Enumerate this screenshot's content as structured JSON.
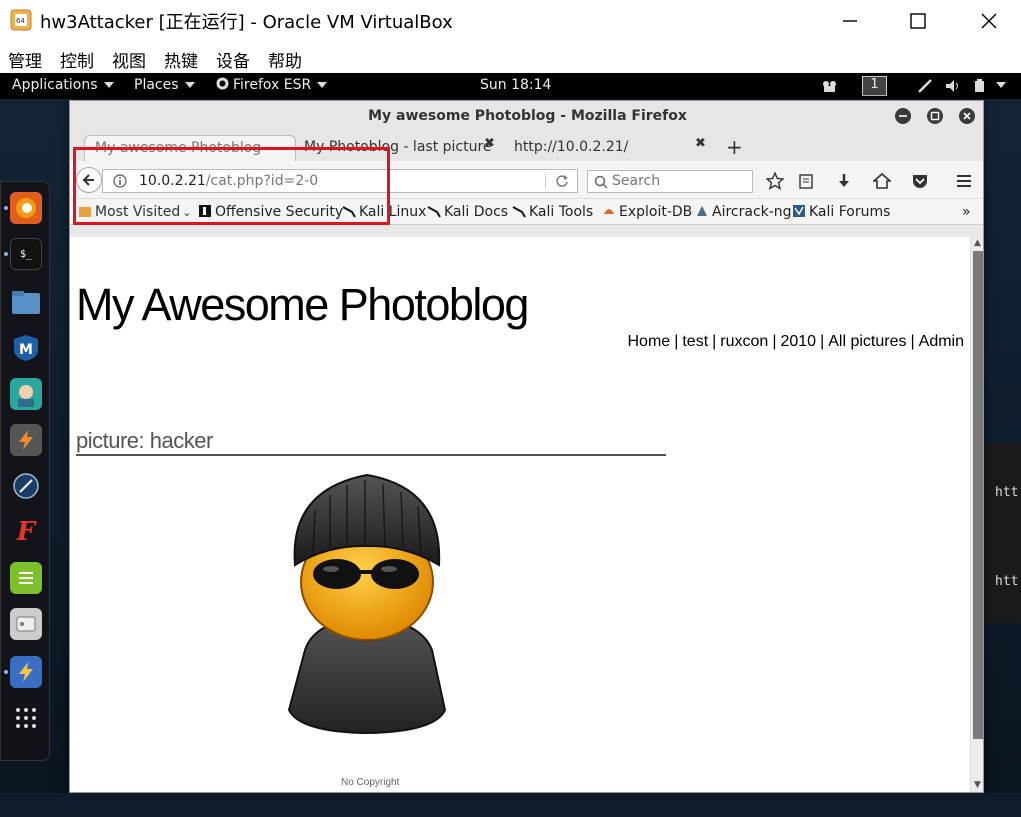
{
  "vbox": {
    "title": "hw3Attacker [正在运行] - Oracle VM VirtualBox",
    "menu": [
      "管理",
      "控制",
      "视图",
      "热键",
      "设备",
      "帮助"
    ]
  },
  "topbar": {
    "applications": "Applications",
    "places": "Places",
    "firefox": "Firefox ESR",
    "clock": "Sun 18:14",
    "workspace": "1"
  },
  "dock": {
    "icons": [
      "firefox-icon",
      "terminal-icon",
      "files-icon",
      "metasploit-icon",
      "armitage-icon",
      "burpsuite-icon",
      "maltego-icon",
      "faraday-icon",
      "leafpad-icon",
      "cutycapt-icon",
      "zaproxy-icon",
      "show-apps-icon"
    ]
  },
  "bg_terminal": {
    "line1": "htt",
    "line2": "htt"
  },
  "firefox": {
    "window_title": "My awesome Photoblog - Mozilla Firefox",
    "tabs": [
      {
        "label": "My awesome Photoblog",
        "active": true
      },
      {
        "label": "My Photoblog - last picture",
        "active": false
      },
      {
        "label": "http://10.0.2.21/",
        "active": false
      }
    ],
    "new_tab": "+",
    "url_host": "10.0.2.21",
    "url_path": "/cat.php?id=2-0",
    "search_placeholder": "Search",
    "bookmarks": [
      "Most Visited",
      "Offensive Security",
      "Kali Linux",
      "Kali Docs",
      "Kali Tools",
      "Exploit-DB",
      "Aircrack-ng",
      "Kali Forums"
    ],
    "bookmarks_overflow": "»"
  },
  "page": {
    "site_title": "My Awesome Photoblog",
    "nav": [
      "Home",
      "test",
      "ruxcon",
      "2010",
      "All pictures",
      "Admin"
    ],
    "picture_heading": "picture: hacker",
    "footer": "No Copyright"
  },
  "colors": {
    "highlight": "#e0141e",
    "topbar": "#000000",
    "dock": "#141418"
  }
}
